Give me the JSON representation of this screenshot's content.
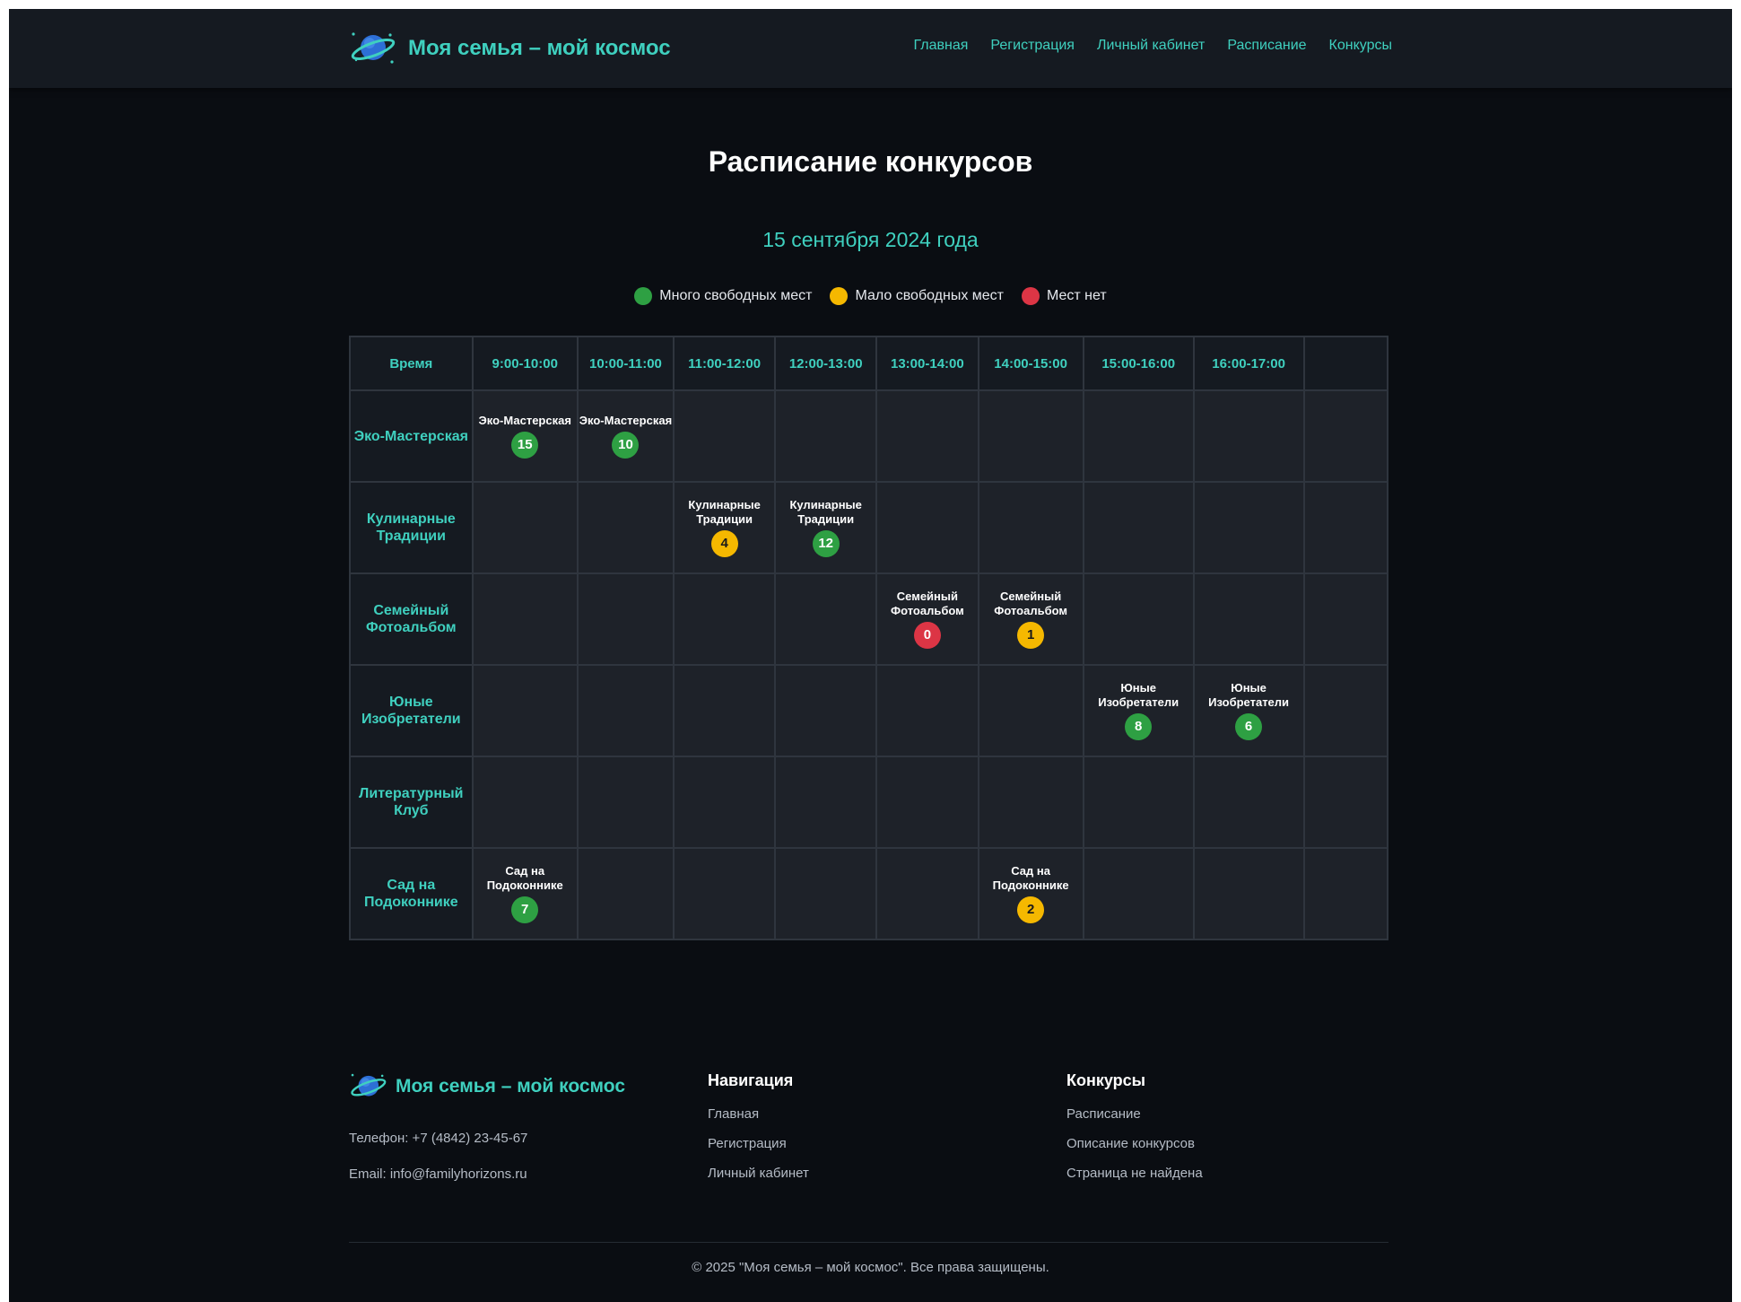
{
  "site": {
    "title": "Моя семья – мой космос"
  },
  "nav": [
    "Главная",
    "Регистрация",
    "Личный кабинет",
    "Расписание",
    "Конкурсы"
  ],
  "page": {
    "title": "Расписание конкурсов",
    "date": "15 сентября 2024 года"
  },
  "colors": {
    "accent": "#3fd0bf",
    "green": "#2ea043",
    "yellow": "#f5b800",
    "red": "#dc3545"
  },
  "legend": [
    {
      "label": "Много свободных мест",
      "status": "green"
    },
    {
      "label": "Мало свободных мест",
      "status": "yellow"
    },
    {
      "label": "Мест нет",
      "status": "red"
    }
  ],
  "schedule": {
    "corner": "Время",
    "times": [
      "9:00-10:00",
      "10:00-11:00",
      "11:00-12:00",
      "12:00-13:00",
      "13:00-14:00",
      "14:00-15:00",
      "15:00-16:00",
      "16:00-17:00"
    ],
    "rows": [
      {
        "name": "Эко-Мастерская",
        "cells": [
          {
            "title": "Эко-Мастерская",
            "seats": "15",
            "status": "green"
          },
          {
            "title": "Эко-Мастерская",
            "seats": "10",
            "status": "green"
          },
          null,
          null,
          null,
          null,
          null,
          null
        ]
      },
      {
        "name": "Кулинарные Традиции",
        "cells": [
          null,
          null,
          {
            "title": "Кулинарные Традиции",
            "seats": "4",
            "status": "yellow"
          },
          {
            "title": "Кулинарные Традиции",
            "seats": "12",
            "status": "green"
          },
          null,
          null,
          null,
          null
        ]
      },
      {
        "name": "Семейный Фотоальбом",
        "cells": [
          null,
          null,
          null,
          null,
          {
            "title": "Семейный Фотоальбом",
            "seats": "0",
            "status": "red"
          },
          {
            "title": "Семейный Фотоальбом",
            "seats": "1",
            "status": "yellow"
          },
          null,
          null
        ]
      },
      {
        "name": "Юные Изобретатели",
        "cells": [
          null,
          null,
          null,
          null,
          null,
          null,
          {
            "title": "Юные Изобретатели",
            "seats": "8",
            "status": "green"
          },
          {
            "title": "Юные Изобретатели",
            "seats": "6",
            "status": "green"
          }
        ]
      },
      {
        "name": "Литературный Клуб",
        "cells": [
          null,
          null,
          null,
          null,
          null,
          null,
          null,
          null
        ]
      },
      {
        "name": "Сад на Подоконнике",
        "cells": [
          {
            "title": "Сад на Подоконнике",
            "seats": "7",
            "status": "green"
          },
          null,
          null,
          null,
          null,
          {
            "title": "Сад на Подоконнике",
            "seats": "2",
            "status": "yellow"
          },
          null,
          null
        ]
      }
    ]
  },
  "footer": {
    "brand": "Моя семья – мой космос",
    "phone": "Телефон: +7 (4842) 23-45-67",
    "email": "Email: info@familyhorizons.ru",
    "nav_title": "Навигация",
    "nav_links": [
      "Главная",
      "Регистрация",
      "Личный кабинет"
    ],
    "contests_title": "Конкурсы",
    "contests_links": [
      "Расписание",
      "Описание конкурсов",
      "Страница не найдена"
    ],
    "copyright": "© 2025 \"Моя семья – мой космос\". Все права защищены."
  }
}
